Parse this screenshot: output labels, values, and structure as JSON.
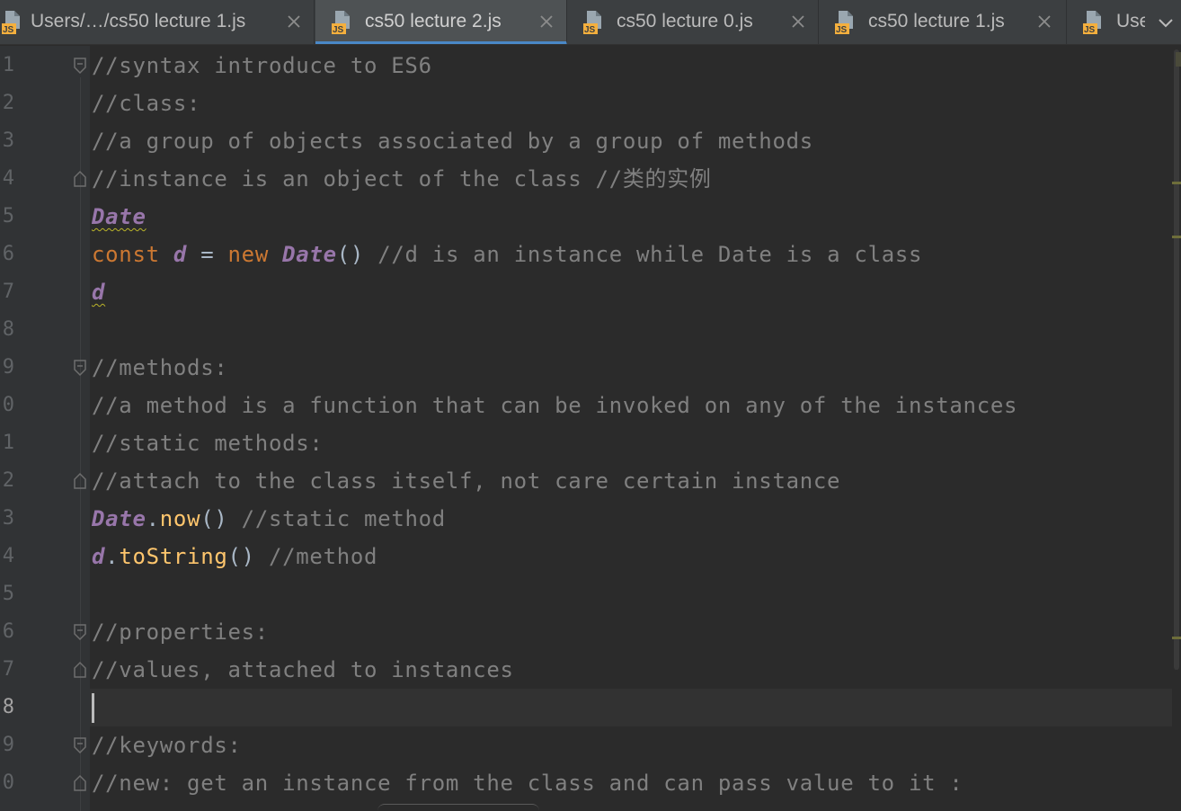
{
  "tabs": [
    {
      "label": "Users/…/cs50 lecture 1.js",
      "icon": "js-file-icon",
      "active": false,
      "closable": true
    },
    {
      "label": "cs50 lecture 2.js",
      "icon": "js-file-icon",
      "active": true,
      "closable": true
    },
    {
      "label": "cs50 lecture 0.js",
      "icon": "js-file-icon",
      "active": false,
      "closable": true
    },
    {
      "label": "cs50 lecture 1.js",
      "icon": "js-file-icon",
      "active": false,
      "closable": true
    },
    {
      "label": "Use",
      "icon": "js-file-icon",
      "active": false,
      "closable": false
    }
  ],
  "file_icon_text": "JS",
  "line_numbers": [
    "1",
    "2",
    "3",
    "4",
    "5",
    "6",
    "7",
    "8",
    "9",
    "0",
    "1",
    "2",
    "3",
    "4",
    "5",
    "6",
    "7",
    "8",
    "9",
    "0"
  ],
  "code": {
    "l1": {
      "c": "//syntax introduce to ES6"
    },
    "l2": {
      "c": "//class:"
    },
    "l3": {
      "c": "//a group of objects associated by a group of methods"
    },
    "l4": {
      "c": "//instance is an object of the class //类的实例"
    },
    "l5": {
      "cls": "Date"
    },
    "l6": {
      "kw1": "const",
      "sp1": " ",
      "var": "d",
      "op": " = ",
      "kw2": "new",
      "sp2": " ",
      "cls": "Date",
      "paren": "()",
      "c": " //d is an instance while Date is a class"
    },
    "l7": {
      "var": "d"
    },
    "l9": {
      "c": "//methods:"
    },
    "l10": {
      "c": "//a method is a function that can be invoked on any of the instances"
    },
    "l11": {
      "c": "//static methods:"
    },
    "l12": {
      "c": "//attach to the class itself, not care certain instance"
    },
    "l13": {
      "cls": "Date",
      "dot": ".",
      "fn": "now",
      "paren": "()",
      "c": " //static method"
    },
    "l14": {
      "var": "d",
      "dot": ".",
      "fn": "toString",
      "paren": "()",
      "c": " //method"
    },
    "l16": {
      "c": "//properties:"
    },
    "l17": {
      "c": "//values, attached to instances"
    },
    "l19": {
      "c": "//keywords:"
    },
    "l20": {
      "c": "//new: get an instance from the class and can pass value to it :"
    }
  },
  "colors": {
    "background": "#2b2b2b",
    "gutter": "#313335",
    "comment": "#808080",
    "keyword": "#cc7832",
    "class_name": "#9876aa",
    "function": "#ffc66d",
    "plain": "#a9b7c6",
    "active_tab_underline": "#4a88c7"
  }
}
